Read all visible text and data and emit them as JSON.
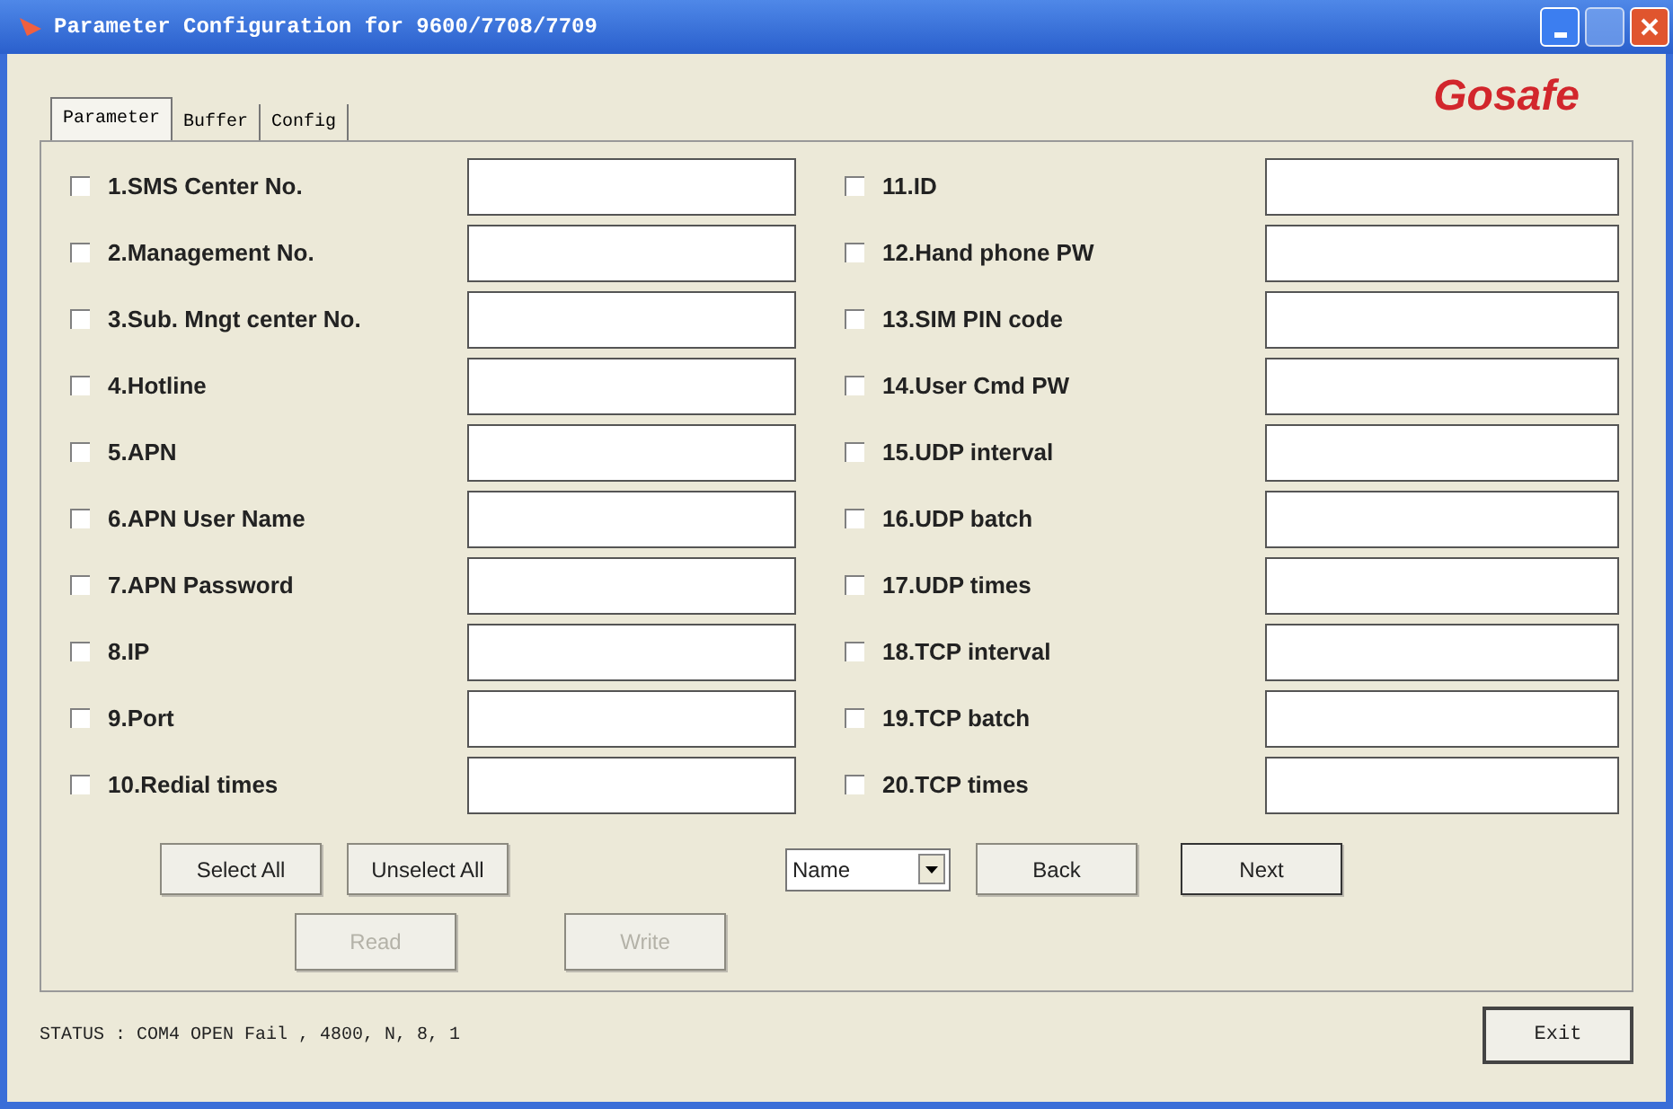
{
  "window": {
    "title": "Parameter Configuration for 9600/7708/7709"
  },
  "logo": "Gosafe",
  "tabs": [
    {
      "label": "Parameter",
      "selected": true
    },
    {
      "label": "Buffer",
      "selected": false
    },
    {
      "label": "Config",
      "selected": false
    }
  ],
  "parameters_left": [
    {
      "label": "1.SMS Center No.",
      "checked": false
    },
    {
      "label": "2.Management No.",
      "checked": false
    },
    {
      "label": "3.Sub. Mngt center No.",
      "checked": false
    },
    {
      "label": "4.Hotline",
      "checked": false
    },
    {
      "label": "5.APN",
      "checked": false
    },
    {
      "label": "6.APN User Name",
      "checked": false
    },
    {
      "label": "7.APN Password",
      "checked": false
    },
    {
      "label": "8.IP",
      "checked": false
    },
    {
      "label": "9.Port",
      "checked": false
    },
    {
      "label": "10.Redial times",
      "checked": false
    }
  ],
  "parameters_right": [
    {
      "label": "11.ID",
      "checked": false
    },
    {
      "label": "12.Hand phone PW",
      "checked": false
    },
    {
      "label": "13.SIM PIN code",
      "checked": false
    },
    {
      "label": "14.User Cmd PW",
      "checked": false
    },
    {
      "label": "15.UDP interval",
      "checked": false
    },
    {
      "label": "16.UDP batch",
      "checked": false
    },
    {
      "label": "17.UDP times",
      "checked": false
    },
    {
      "label": "18.TCP interval",
      "checked": false
    },
    {
      "label": "19.TCP batch",
      "checked": false
    },
    {
      "label": "20.TCP times",
      "checked": false
    }
  ],
  "select_buttons": [
    {
      "label": "Select All",
      "disabled": false
    },
    {
      "label": "Unselect All",
      "disabled": false
    }
  ],
  "dropdown": {
    "value": "Name"
  },
  "nav_buttons": [
    {
      "label": "Back",
      "disabled": false
    },
    {
      "label": "Next",
      "disabled": false
    }
  ],
  "io_buttons": [
    {
      "label": "Read",
      "disabled": true
    },
    {
      "label": "Write",
      "disabled": true
    }
  ],
  "status_bar": "STATUS : COM4 OPEN Fail , 4800, N, 8, 1",
  "exit_button": "Exit"
}
